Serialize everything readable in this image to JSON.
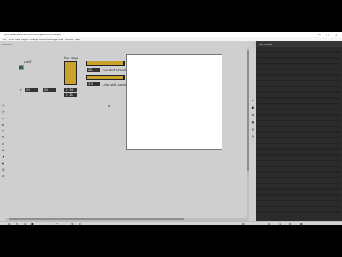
{
  "window": {
    "title": "Demo/example/chaos pendulum/pendulums.maxpat",
    "controls": {
      "minimize": "—",
      "maximize": "□",
      "close": "✕"
    }
  },
  "menu": [
    "File",
    "Edit",
    "View",
    "Object",
    "Arrange",
    "Options",
    "Debug",
    "Extras",
    "Window",
    "Help"
  ],
  "tab": {
    "label": "Patcher 1"
  },
  "sidepanel": {
    "title": "Max Console"
  },
  "patch": {
    "onoff_label": "on/off",
    "box_range_label": "box range",
    "box_shift_label": "box shift amount",
    "color_shift_label": "color shift amount",
    "num_left_1": "0",
    "num_left_2": "26",
    "num_left_3": "64",
    "num_slider_1": "0. 14",
    "num_slider_2": "0. 11",
    "num_shift": "20.",
    "num_color": "1.9",
    "slider_level": 0.9
  },
  "left_toolbar": [
    "ⓘ",
    "ⓐ",
    "▭",
    "▤",
    "✎",
    "⤧",
    "⊟",
    "⊕",
    "✦",
    "◐",
    "◑",
    "☰"
  ],
  "right_toolbar": [
    "⌕",
    "▣",
    "▤",
    "▦",
    "◍",
    "◎"
  ],
  "bottom_toolbar": [
    "⊞",
    "✎",
    "⊡",
    "◧",
    "⬚",
    "⤢",
    "⊕",
    "⊟",
    "▤",
    "⊞",
    "⊡",
    "◍",
    "▦"
  ]
}
